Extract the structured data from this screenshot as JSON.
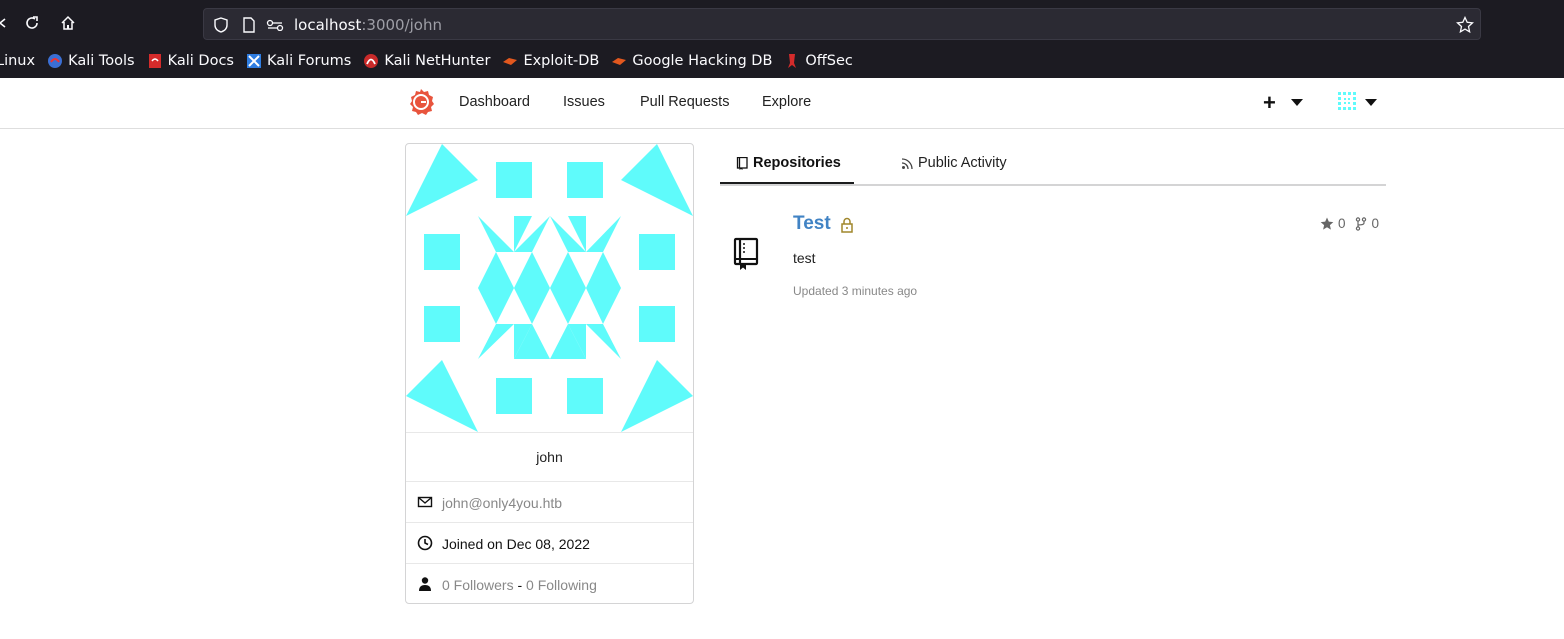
{
  "browser": {
    "url_host": "localhost",
    "url_rest": ":3000/john",
    "bookmarks": [
      {
        "label": "Linux",
        "icon": "kali-linux-icon"
      },
      {
        "label": "Kali Tools",
        "icon": "kali-tools-icon"
      },
      {
        "label": "Kali Docs",
        "icon": "kali-docs-icon"
      },
      {
        "label": "Kali Forums",
        "icon": "kali-forums-icon"
      },
      {
        "label": "Kali NetHunter",
        "icon": "kali-nethunter-icon"
      },
      {
        "label": "Exploit-DB",
        "icon": "exploit-db-icon"
      },
      {
        "label": "Google Hacking DB",
        "icon": "google-hacking-db-icon"
      },
      {
        "label": "OffSec",
        "icon": "offsec-icon"
      }
    ]
  },
  "header": {
    "nav": [
      "Dashboard",
      "Issues",
      "Pull Requests",
      "Explore"
    ],
    "plus_label": "+"
  },
  "profile": {
    "username": "john",
    "email": "john@only4you.htb",
    "joined": "Joined on Dec 08, 2022",
    "followers": "0 Followers",
    "separator": "-",
    "following": "0 Following",
    "avatar_color": "#5ffbfb"
  },
  "tabs": {
    "repositories": "Repositories",
    "activity": "Public Activity"
  },
  "repo": {
    "name": "Test",
    "description": "test",
    "updated": "Updated 3 minutes ago",
    "stars": "0",
    "forks": "0",
    "link_color": "#4183c4",
    "lock_color": "#a0872c"
  }
}
